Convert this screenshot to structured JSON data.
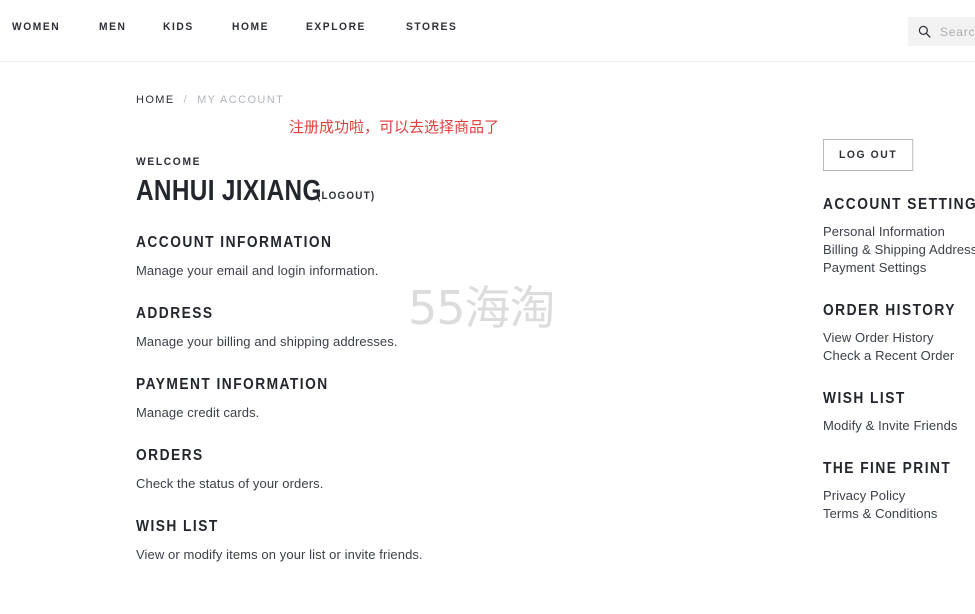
{
  "header": {
    "nav_items": [
      {
        "label": "WOMEN"
      },
      {
        "label": "MEN"
      },
      {
        "label": "KIDS"
      },
      {
        "label": "HOME"
      },
      {
        "label": "EXPLORE"
      },
      {
        "label": "STORES"
      }
    ],
    "search": {
      "icon": "search-icon",
      "placeholder": "Search",
      "value": ""
    }
  },
  "breadcrumb": {
    "home": "HOME",
    "separator": "/",
    "current": "MY ACCOUNT"
  },
  "notice": {
    "text": "注册成功啦，可以去选择商品了",
    "color": "#e1403d"
  },
  "watermark": {
    "text": "55海淘",
    "color": "#dcdcdc"
  },
  "account": {
    "welcome_label": "WELCOME",
    "user_name": "ANHUI JIXIANG",
    "logout_inline": "(LOGOUT)",
    "sections": [
      {
        "title": "ACCOUNT INFORMATION",
        "description": "Manage your email and login information."
      },
      {
        "title": "ADDRESS",
        "description": "Manage your billing and shipping addresses."
      },
      {
        "title": "PAYMENT INFORMATION",
        "description": "Manage credit cards."
      },
      {
        "title": "ORDERS",
        "description": "Check the status of your orders."
      },
      {
        "title": "WISH LIST",
        "description": "View or modify items on your list or invite friends."
      }
    ]
  },
  "sidebar": {
    "logout_button": "LOG OUT",
    "blocks": [
      {
        "title": "ACCOUNT SETTINGS",
        "links": [
          "Personal Information",
          "Billing & Shipping Addresses",
          "Payment Settings"
        ]
      },
      {
        "title": "ORDER HISTORY",
        "links": [
          "View Order History",
          "Check a Recent Order"
        ]
      },
      {
        "title": "WISH LIST",
        "links": [
          "Modify & Invite Friends"
        ]
      },
      {
        "title": "THE FINE PRINT",
        "links": [
          "Privacy Policy",
          "Terms & Conditions"
        ]
      }
    ]
  }
}
